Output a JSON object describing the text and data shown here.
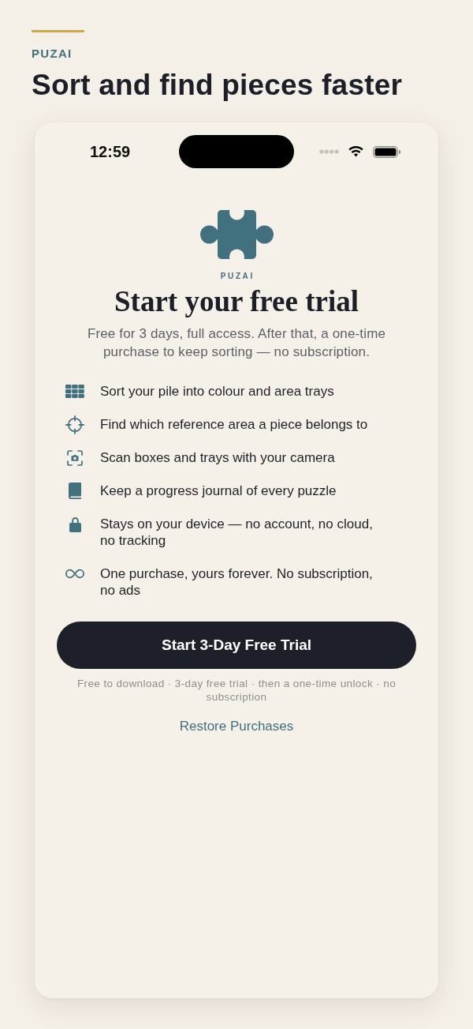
{
  "header": {
    "eyebrow": "PUZAI",
    "title": "Sort and find pieces faster"
  },
  "phone": {
    "status_bar": {
      "time": "12:59"
    },
    "paywall": {
      "brand": "PUZAI",
      "title": "Start your free trial",
      "subtitle": "Free for 3 days, full access. After that, a one-time purchase to keep sorting — no subscription.",
      "features": [
        {
          "text": "Sort your pile into colour and area trays"
        },
        {
          "text": "Find which reference area a piece belongs to"
        },
        {
          "text": "Scan boxes and trays with your camera"
        },
        {
          "text": "Keep a progress journal of every puzzle"
        },
        {
          "text": "Stays on your device — no account, no cloud, no tracking"
        },
        {
          "text": "One purchase, yours forever. No subscription, no ads"
        }
      ],
      "cta": "Start 3-Day Free Trial",
      "fine_print": "Free to download · 3-day free trial · then a one-time unlock · no subscription",
      "restore": "Restore Purchases"
    }
  }
}
